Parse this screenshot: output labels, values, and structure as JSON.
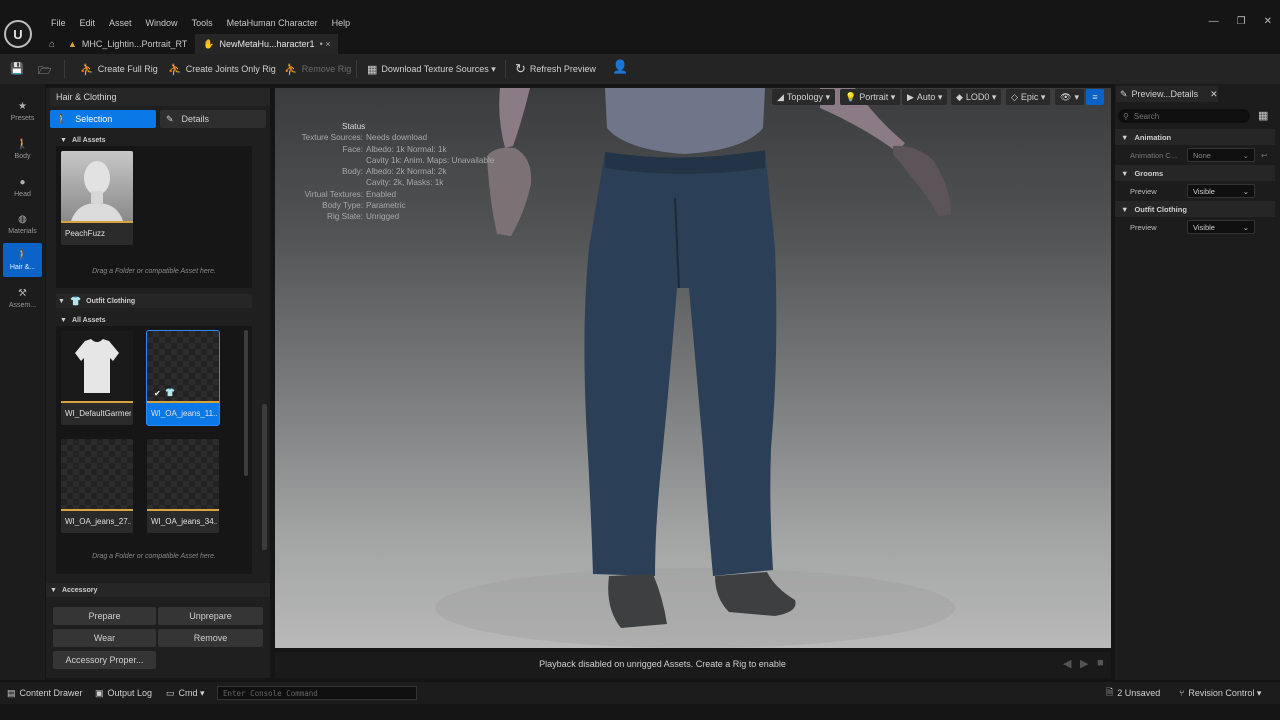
{
  "menu": [
    "File",
    "Edit",
    "Asset",
    "Window",
    "Tools",
    "MetaHuman Character",
    "Help"
  ],
  "tabs": [
    {
      "label": "MHC_Lightin...Portrait_RT"
    },
    {
      "label": "NewMetaHu...haracter1",
      "suffix": "• ×"
    }
  ],
  "toolbar": {
    "create_full_rig": "Create Full Rig",
    "create_joints_only_rig": "Create Joints Only Rig",
    "remove_rig": "Remove Rig",
    "download_texture_sources": "Download Texture Sources ▾",
    "refresh_preview": "Refresh Preview"
  },
  "sidebar": [
    "Presets",
    "Body",
    "Head",
    "Materials",
    "Hair &...",
    "Assem..."
  ],
  "panel": {
    "title": "Hair & Clothing",
    "selection_tab": "Selection",
    "details_tab": "Details",
    "all_assets": "All Assets",
    "peachfuzz": "PeachFuzz",
    "drag_hint": "Drag a Folder or compatible Asset here.",
    "outfit_clothing": "Outfit Clothing",
    "outfit_all_assets": "All Assets",
    "outfit_cards": [
      "WI_DefaultGarment",
      "WI_OA_jeans_11...",
      "WI_OA_jeans_27...",
      "WI_OA_jeans_34..."
    ],
    "drag_hint_2": "Drag a Folder or compatible Asset here.",
    "accessory": "Accessory",
    "acc_buttons": [
      "Prepare",
      "Unprepare",
      "Wear",
      "Remove",
      "Accessory Proper..."
    ]
  },
  "viewport_toolbar": [
    "Topology ▾",
    "Portrait ▾",
    "Auto ▾",
    "LOD0 ▾",
    "Epic ▾"
  ],
  "status": {
    "title": "Status",
    "rows": [
      {
        "k": "Texture Sources:",
        "v": "Needs download"
      },
      {
        "k": "Face:",
        "v": "Albedo: 1k Normal: 1k"
      },
      {
        "k": "",
        "v": "Cavity 1k: Anim. Maps: Unavailable"
      },
      {
        "k": "Body:",
        "v": "Albedo: 2k Normal: 2k"
      },
      {
        "k": "",
        "v": "Cavity: 2k, Masks: 1k"
      },
      {
        "k": "Virtual Textures:",
        "v": "Enabled"
      },
      {
        "k": "Body Type:",
        "v": "Parametric"
      },
      {
        "k": "Rig State:",
        "v": "Unrigged"
      }
    ]
  },
  "playback": "Playback disabled on unrigged Assets. Create a Rig to enable",
  "details": {
    "tab": "Preview...Details",
    "search_placeholder": "Search",
    "animation": "Animation",
    "animation_row": "Animation C...",
    "animation_value": "None",
    "grooms": "Grooms",
    "grooms_row": "Preview",
    "grooms_value": "Visible",
    "outfit": "Outfit Clothing",
    "outfit_row": "Preview",
    "outfit_value": "Visible"
  },
  "bottom": {
    "content_drawer": "Content Drawer",
    "output_log": "Output Log",
    "cmd": "Cmd ▾",
    "console_placeholder": "Enter Console Command",
    "unsaved": "2 Unsaved",
    "revision": "Revision Control ▾"
  },
  "colors": {
    "accent": "#0b78e8",
    "asset_stripe": "#d7a33b"
  }
}
